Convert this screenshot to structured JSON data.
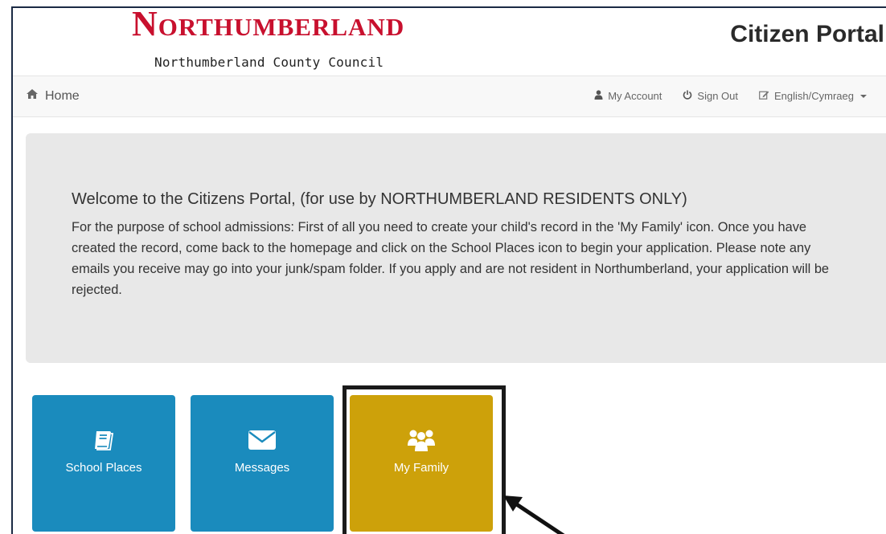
{
  "header": {
    "logo_wordmark": "Northumberland",
    "logo_subtitle": "Northumberland County Council",
    "portal_title": "Citizen Portal"
  },
  "nav": {
    "home_label": "Home",
    "my_account_label": "My Account",
    "sign_out_label": "Sign Out",
    "language_label": "English/Cymraeg"
  },
  "welcome": {
    "title": "Welcome to the Citizens Portal, (for use by NORTHUMBERLAND RESIDENTS ONLY)",
    "body": "For the purpose of school admissions: First of all you need to create your child's record in the 'My Family' icon. Once you have created the record, come back to the homepage and click on the School Places icon to begin your application. Please note any emails you receive may go into your junk/spam folder. If you apply and are not resident in Northumberland, your application will be rejected."
  },
  "tiles": [
    {
      "label": "School Places",
      "icon": "book-icon",
      "color": "#1a8bbd"
    },
    {
      "label": "Messages",
      "icon": "envelope-icon",
      "color": "#1a8bbd"
    },
    {
      "label": "My Family",
      "icon": "family-icon",
      "color": "#cda10a"
    }
  ],
  "colors": {
    "brand_red": "#c8102e",
    "tile_blue": "#1a8bbd",
    "tile_gold": "#cda10a",
    "panel_gray": "#e8e8e8"
  }
}
